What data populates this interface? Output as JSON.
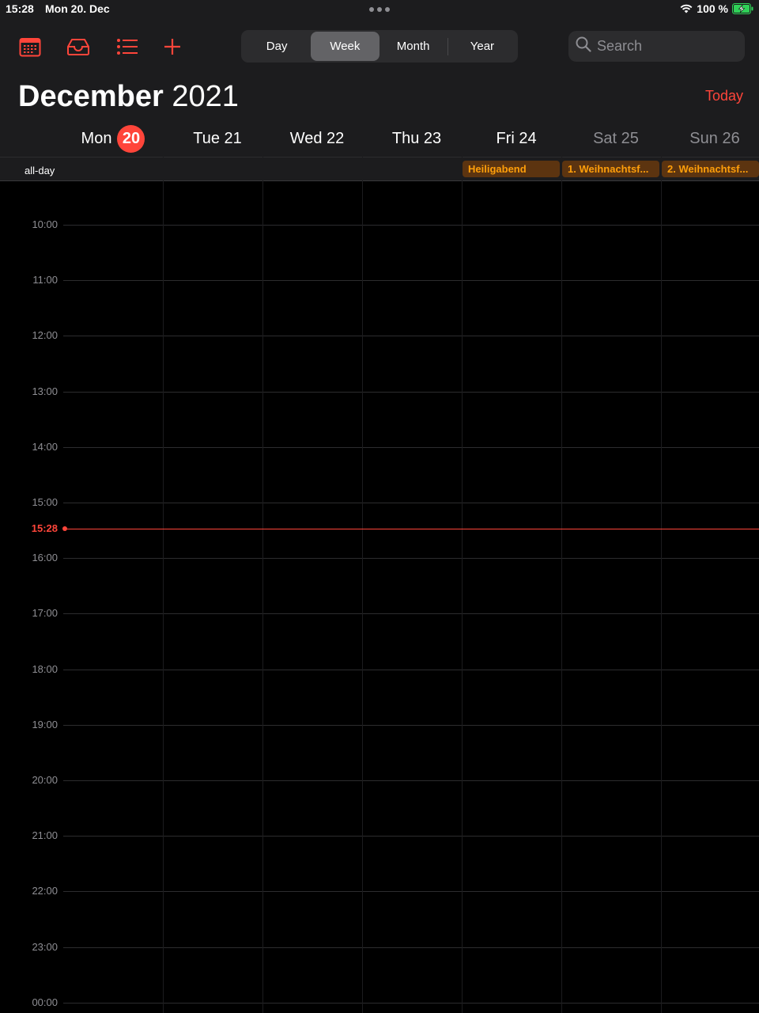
{
  "status": {
    "time": "15:28",
    "date": "Mon 20. Dec",
    "battery": "100 %"
  },
  "toolbar": {
    "icons": [
      "calendar-icon",
      "inbox-icon",
      "list-icon",
      "add-icon"
    ],
    "views": [
      "Day",
      "Week",
      "Month",
      "Year"
    ],
    "active_view": "Week",
    "search_placeholder": "Search",
    "today_label": "Today"
  },
  "header": {
    "month": "December",
    "year": "2021"
  },
  "days": [
    {
      "label": "Mon",
      "num": "20",
      "today": true
    },
    {
      "label": "Tue 21",
      "weekend": false
    },
    {
      "label": "Wed 22",
      "weekend": false
    },
    {
      "label": "Thu 23",
      "weekend": false
    },
    {
      "label": "Fri 24",
      "weekend": false
    },
    {
      "label": "Sat 25",
      "weekend": true
    },
    {
      "label": "Sun 26",
      "weekend": true
    }
  ],
  "allday": {
    "label": "all-day",
    "events": [
      {
        "day": "Fri 24",
        "title": "Heiligabend"
      },
      {
        "day": "Sat 25",
        "title": "1. Weihnachtsf..."
      },
      {
        "day": "Sun 26",
        "title": "2. Weihnachtsf..."
      }
    ]
  },
  "hours": [
    "10:00",
    "11:00",
    "12:00",
    "13:00",
    "14:00",
    "15:00",
    "16:00",
    "17:00",
    "18:00",
    "19:00",
    "20:00",
    "21:00",
    "22:00",
    "23:00",
    "00:00"
  ],
  "now": "15:28",
  "colors": {
    "accent": "#ff453a",
    "event_text": "#ff9f0a",
    "event_bg": "#5c3410"
  }
}
